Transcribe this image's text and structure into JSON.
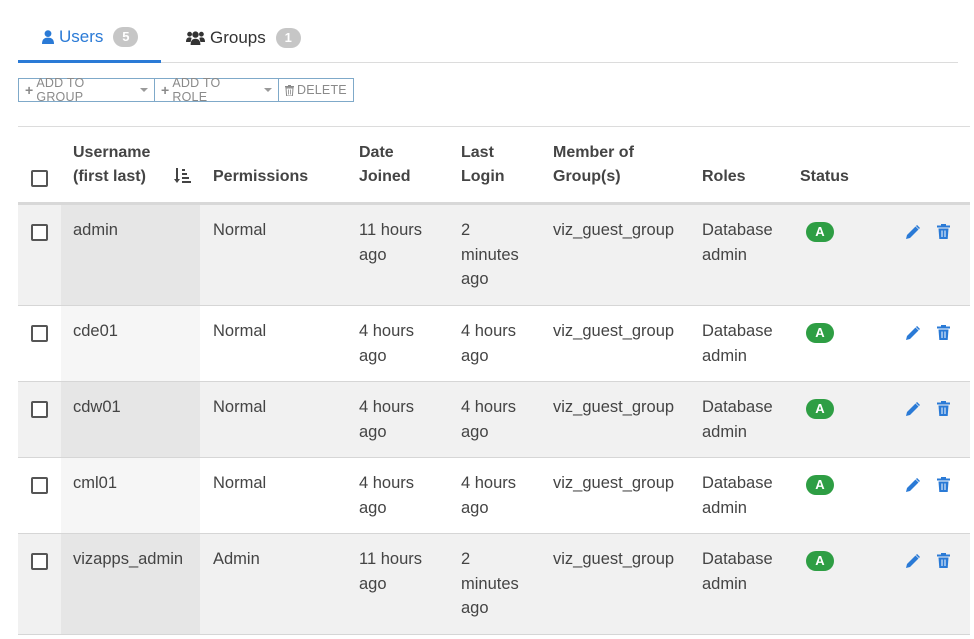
{
  "tabs": [
    {
      "label": "Users",
      "count": "5"
    },
    {
      "label": "Groups",
      "count": "1"
    }
  ],
  "toolbar": {
    "add_to_group": "ADD TO GROUP",
    "add_to_role": "ADD TO ROLE",
    "delete": "DELETE"
  },
  "table": {
    "headers": {
      "username": [
        "Username",
        "(first last)"
      ],
      "permissions": "Permissions",
      "date_joined": [
        "Date",
        "Joined"
      ],
      "last_login": [
        "Last",
        "Login"
      ],
      "member_of": [
        "Member of",
        "Group(s)"
      ],
      "roles": "Roles",
      "status": "Status"
    },
    "rows": [
      {
        "username": "admin",
        "permissions": "Normal",
        "date_joined": [
          "11 hours",
          "ago"
        ],
        "last_login": [
          "2",
          "minutes",
          "ago"
        ],
        "groups": "viz_guest_group",
        "roles": [
          "Database",
          "admin"
        ],
        "status": "A"
      },
      {
        "username": "cde01",
        "permissions": "Normal",
        "date_joined": [
          "4 hours",
          "ago"
        ],
        "last_login": [
          "4 hours",
          "ago"
        ],
        "groups": "viz_guest_group",
        "roles": [
          "Database",
          "admin"
        ],
        "status": "A"
      },
      {
        "username": "cdw01",
        "permissions": "Normal",
        "date_joined": [
          "4 hours",
          "ago"
        ],
        "last_login": [
          "4 hours",
          "ago"
        ],
        "groups": "viz_guest_group",
        "roles": [
          "Database",
          "admin"
        ],
        "status": "A"
      },
      {
        "username": "cml01",
        "permissions": "Normal",
        "date_joined": [
          "4 hours",
          "ago"
        ],
        "last_login": [
          "4 hours",
          "ago"
        ],
        "groups": "viz_guest_group",
        "roles": [
          "Database",
          "admin"
        ],
        "status": "A"
      },
      {
        "username": "vizapps_admin",
        "permissions": "Admin",
        "date_joined": [
          "11 hours",
          "ago"
        ],
        "last_login": [
          "2",
          "minutes",
          "ago"
        ],
        "groups": "viz_guest_group",
        "roles": [
          "Database",
          "admin"
        ],
        "status": "A"
      }
    ]
  },
  "colors": {
    "accent": "#2a7ad6",
    "status_active": "#2e9e44",
    "badge": "#c6c6c6"
  },
  "icons": [
    "user-icon",
    "users-icon",
    "plus-icon",
    "trash-icon",
    "sort-amount-icon",
    "pencil-icon",
    "trash-icon"
  ]
}
